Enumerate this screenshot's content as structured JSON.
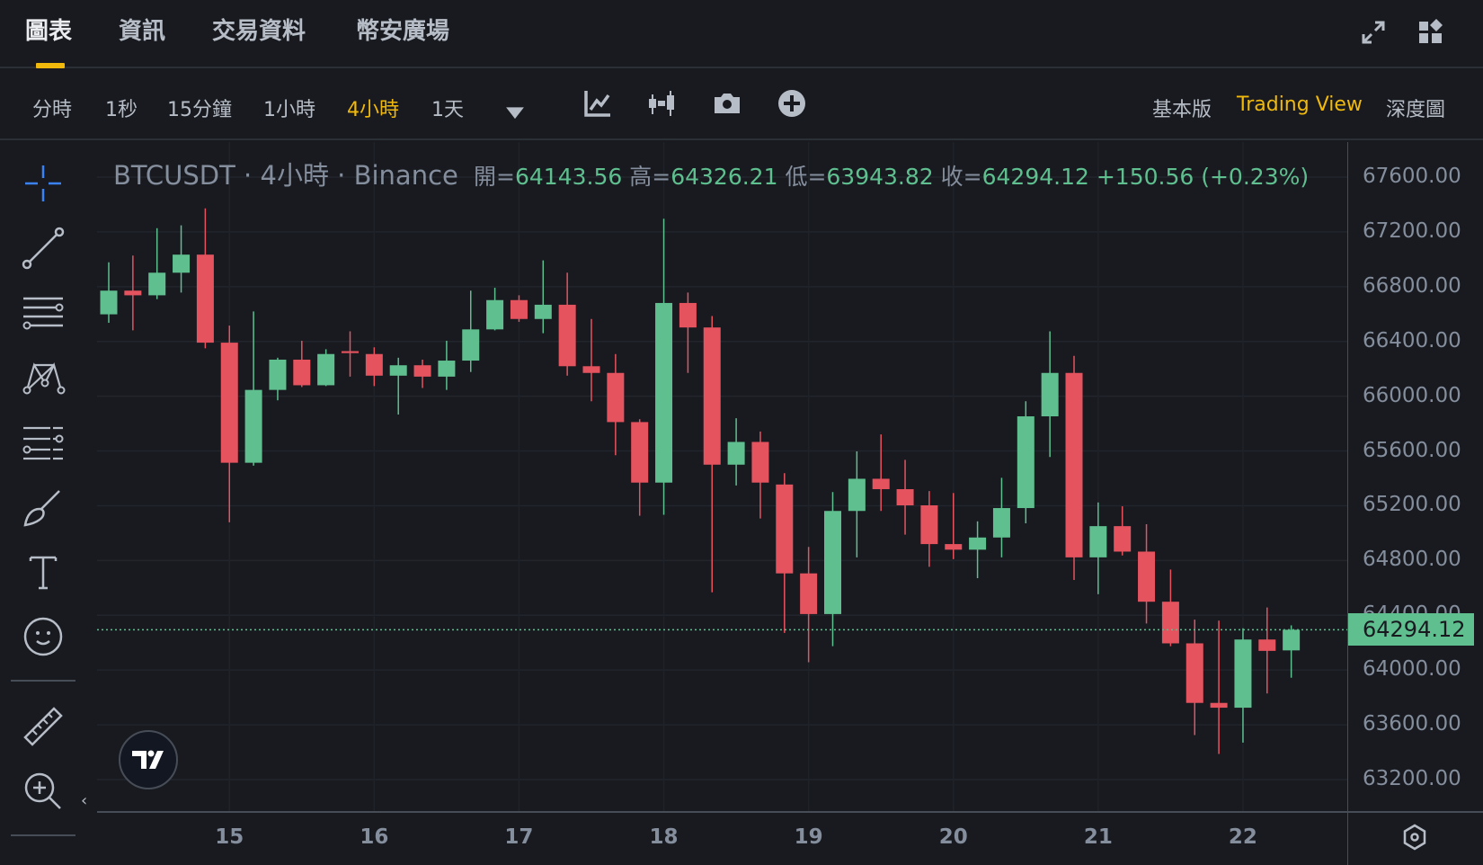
{
  "top_tabs": [
    {
      "label": "圖表",
      "active": true
    },
    {
      "label": "資訊"
    },
    {
      "label": "交易資料"
    },
    {
      "label": "幣安廣場"
    }
  ],
  "top_icons": [
    "expand-icon",
    "layout-widget-icon"
  ],
  "intervals": [
    {
      "label": "分時"
    },
    {
      "label": "1秒"
    },
    {
      "label": "15分鐘"
    },
    {
      "label": "1小時"
    },
    {
      "label": "4小時",
      "active": true
    },
    {
      "label": "1天"
    }
  ],
  "toolbar_icons": [
    "more-intervals-dropdown-icon",
    "indicators-icon",
    "chart-type-icon",
    "screenshot-icon",
    "add-icon"
  ],
  "views": [
    {
      "label": "基本版"
    },
    {
      "label": "Trading View",
      "active": true
    },
    {
      "label": "深度圖"
    }
  ],
  "legend": {
    "symbol": "BTCUSDT · 4小時 · Binance",
    "open_label": "開=",
    "open": "64143.56",
    "high_label": "高=",
    "high": "64326.21",
    "low_label": "低=",
    "low": "63943.82",
    "close_label": "收=",
    "close": "64294.12",
    "change": "+150.56 (+0.23%)"
  },
  "colors": {
    "up": "#5fbf8f",
    "down": "#e5535f",
    "accent": "#f0b90b",
    "background": "#181a20"
  },
  "chart_data": {
    "type": "candlestick",
    "symbol": "BTCUSDT",
    "interval": "4h",
    "y_ticks": [
      "67600.00",
      "67200.00",
      "66800.00",
      "66400.00",
      "66000.00",
      "65600.00",
      "65200.00",
      "64800.00",
      "64400.00",
      "64000.00",
      "63600.00",
      "63200.00"
    ],
    "ylim": [
      63200,
      67600
    ],
    "x_ticks": [
      {
        "label": "15",
        "index": 5
      },
      {
        "label": "16",
        "index": 11
      },
      {
        "label": "17",
        "index": 17
      },
      {
        "label": "18",
        "index": 23
      },
      {
        "label": "19",
        "index": 29
      },
      {
        "label": "20",
        "index": 35
      },
      {
        "label": "21",
        "index": 41
      },
      {
        "label": "22",
        "index": 47
      }
    ],
    "last_price": "64294.12",
    "ohlc": [
      [
        66598,
        66978,
        66536,
        66771
      ],
      [
        66771,
        67027,
        66481,
        66737
      ],
      [
        66737,
        67227,
        66709,
        66902
      ],
      [
        66902,
        67248,
        66757,
        67034
      ],
      [
        67034,
        67372,
        66350,
        66391
      ],
      [
        66391,
        66516,
        65079,
        65514
      ],
      [
        65514,
        66619,
        65493,
        66046
      ],
      [
        66046,
        66281,
        65970,
        66267
      ],
      [
        66267,
        66405,
        66067,
        66080
      ],
      [
        66080,
        66343,
        66074,
        66308
      ],
      [
        66329,
        66474,
        66143,
        66315
      ],
      [
        66308,
        66357,
        66074,
        66150
      ],
      [
        66150,
        66281,
        65866,
        66226
      ],
      [
        66226,
        66267,
        66060,
        66143
      ],
      [
        66143,
        66405,
        66046,
        66260
      ],
      [
        66260,
        66771,
        66177,
        66488
      ],
      [
        66488,
        66792,
        66481,
        66702
      ],
      [
        66702,
        66737,
        66543,
        66564
      ],
      [
        66564,
        66992,
        66460,
        66668
      ],
      [
        66668,
        66902,
        66150,
        66219
      ],
      [
        66219,
        66564,
        65963,
        66170
      ],
      [
        66170,
        66308,
        65569,
        65811
      ],
      [
        65811,
        65832,
        65127,
        65369
      ],
      [
        65369,
        67296,
        65134,
        66681
      ],
      [
        66681,
        66757,
        66170,
        66502
      ],
      [
        66502,
        66585,
        64568,
        65500
      ],
      [
        65500,
        65839,
        65348,
        65666
      ],
      [
        65666,
        65742,
        65107,
        65369
      ],
      [
        65355,
        65438,
        64271,
        64706
      ],
      [
        64706,
        64899,
        64057,
        64409
      ],
      [
        64409,
        65300,
        64174,
        65162
      ],
      [
        65162,
        65597,
        64823,
        65397
      ],
      [
        65397,
        65721,
        65162,
        65321
      ],
      [
        65321,
        65535,
        64989,
        65203
      ],
      [
        65203,
        65307,
        64754,
        64920
      ],
      [
        64920,
        65293,
        64810,
        64879
      ],
      [
        64879,
        65086,
        64671,
        64968
      ],
      [
        64968,
        65404,
        64823,
        65183
      ],
      [
        65183,
        65963,
        65072,
        65853
      ],
      [
        65853,
        66474,
        65556,
        66170
      ],
      [
        66170,
        66295,
        64658,
        64823
      ],
      [
        64823,
        65224,
        64554,
        65051
      ],
      [
        65051,
        65196,
        64837,
        64865
      ],
      [
        64865,
        65065,
        64340,
        64499
      ],
      [
        64499,
        64734,
        64174,
        64195
      ],
      [
        64195,
        64368,
        63525,
        63760
      ],
      [
        63760,
        64361,
        63387,
        63725
      ],
      [
        63725,
        64305,
        63470,
        64223
      ],
      [
        64223,
        64457,
        63829,
        64140
      ],
      [
        64143.56,
        64326.21,
        63943.82,
        64294.12
      ]
    ]
  }
}
